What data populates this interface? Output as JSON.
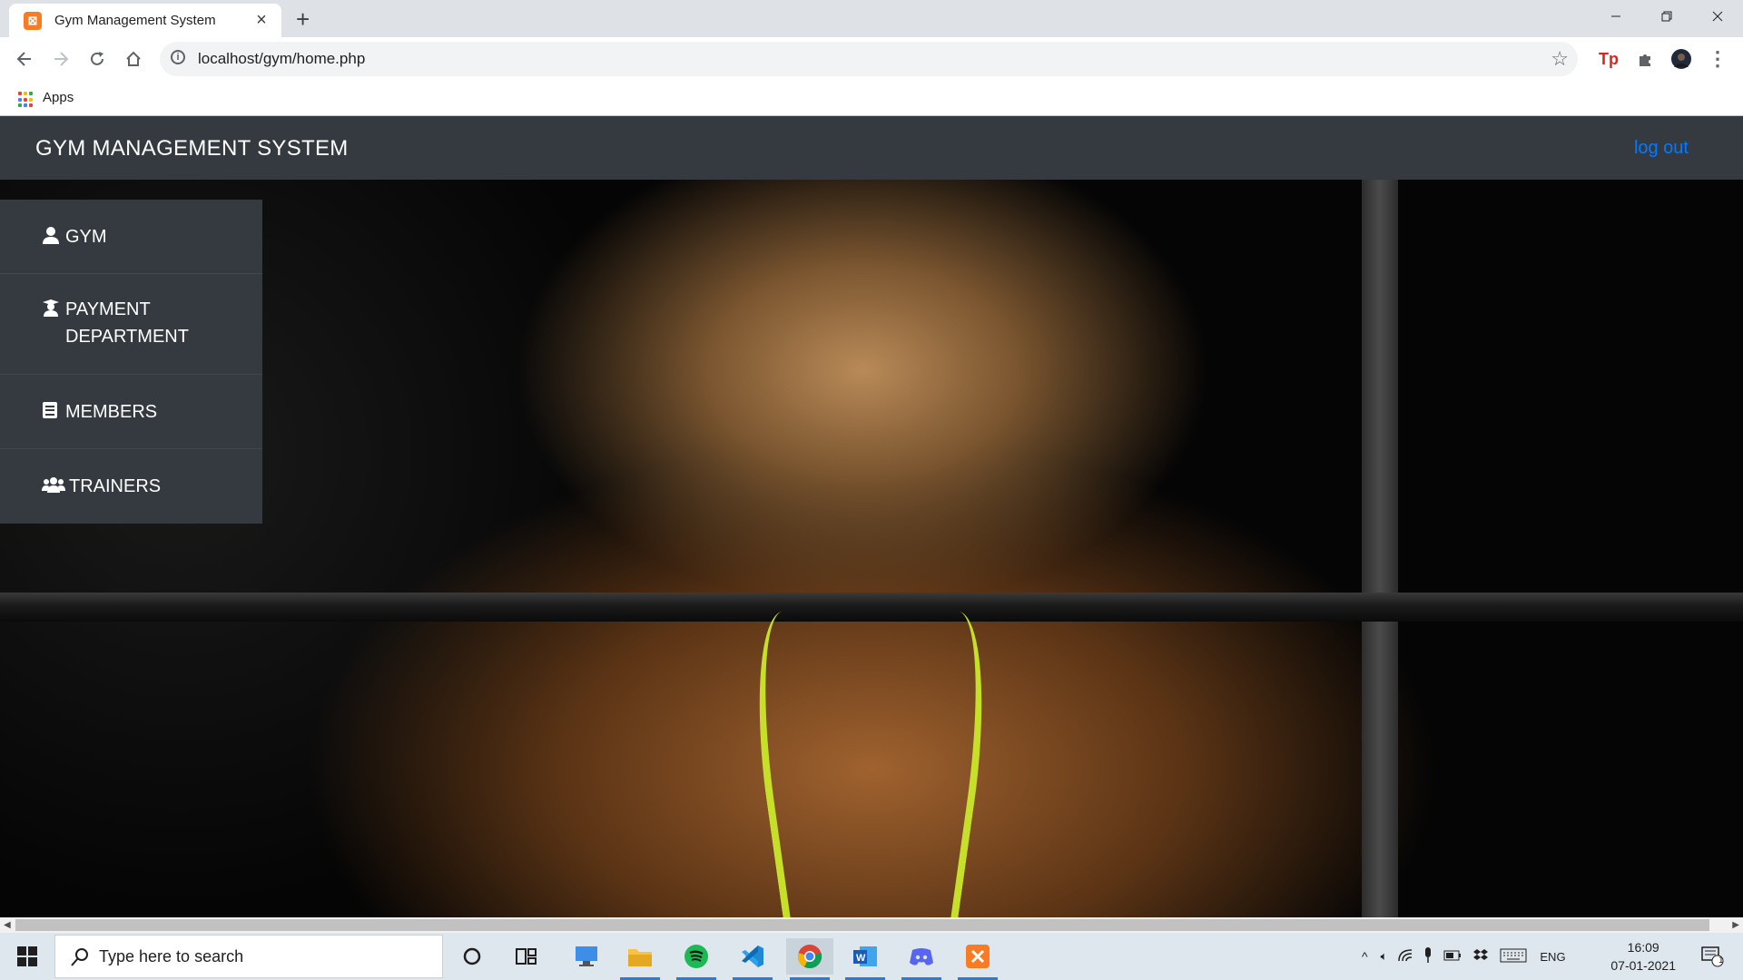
{
  "browser": {
    "tab_title": "Gym Management System",
    "favicon_letter": "⊠",
    "url": "localhost/gym/home.php",
    "bookmarks_apps_label": "Apps"
  },
  "navbar": {
    "brand": "GYM MANAGEMENT SYSTEM",
    "logout_label": "log out",
    "logout_color": "#007bff"
  },
  "sidebar": {
    "items": [
      {
        "icon": "user-icon",
        "label": "GYM"
      },
      {
        "icon": "user-graduate-icon",
        "label": "PAYMENT DEPARTMENT"
      },
      {
        "icon": "book-icon",
        "label": "MEMBERS"
      },
      {
        "icon": "users-icon",
        "label": "TRAINERS"
      }
    ]
  },
  "taskbar": {
    "search_placeholder": "Type here to search",
    "language": "ENG",
    "time": "16:09",
    "date": "07-01-2021",
    "notification_count": "1"
  },
  "colors": {
    "navbar_bg": "#343a40",
    "sidebar_bg": "#343a40",
    "taskbar_bg": "#dfe7ee"
  }
}
